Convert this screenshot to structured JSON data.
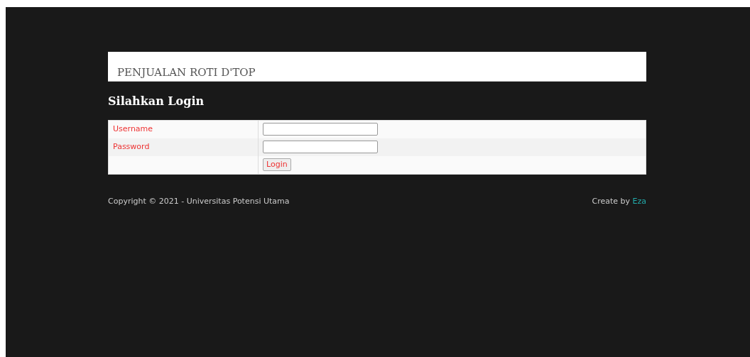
{
  "header": {
    "title": "PENJUALAN ROTI D'TOP"
  },
  "heading": "Silahkan Login",
  "form": {
    "fields": [
      {
        "label": "Username"
      },
      {
        "label": "Password"
      }
    ],
    "button": "Login"
  },
  "footer": {
    "copyright": "Copyright © 2021 - Universitas Potensi Utama",
    "credit": "Create by",
    "author": "Eza"
  }
}
